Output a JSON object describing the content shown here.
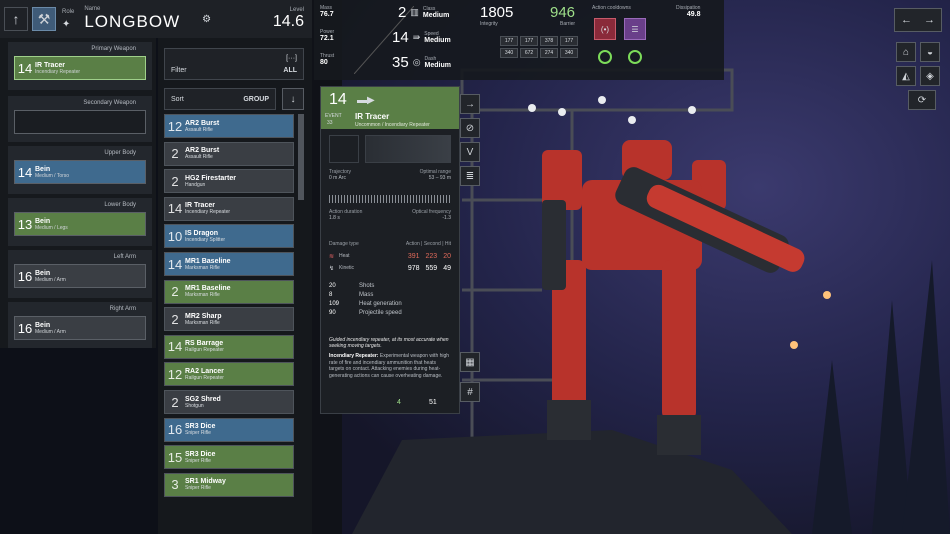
{
  "header": {
    "role_label": "Role",
    "name_label": "Name",
    "name": "LONGBOW",
    "level_label": "Level",
    "level": "14.6"
  },
  "top_stats": {
    "mass_label": "Mass",
    "mass": "76.7",
    "power_label": "Power",
    "power": "72.1",
    "thrust_label": "Thrust",
    "thrust": "80",
    "class_num": "2",
    "class_label": "Class",
    "class_val": "Medium",
    "speed_num": "14",
    "speed_label": "Speed",
    "speed_val": "Medium",
    "dash_num": "35",
    "dash_label": "Dash",
    "dash_val": "Medium",
    "integrity": "1805",
    "integrity_label": "Integrity",
    "barrier": "946",
    "barrier_label": "Barrier",
    "grid": [
      "177",
      "177",
      "378",
      "177",
      "340",
      "672",
      "274",
      "340"
    ],
    "cooldowns_label": "Action cooldowns",
    "dissipation_label": "Dissipation",
    "dissipation": "49.8"
  },
  "left": {
    "slots": [
      {
        "title": "Primary Weapon",
        "num": "14",
        "name": "IR Tracer",
        "sub": "Incendiary Repeater"
      },
      {
        "title": "Secondary Weapon",
        "num": "",
        "name": "",
        "sub": ""
      },
      {
        "title": "Upper Body",
        "num": "14",
        "name": "Bein",
        "sub": "Medium / Torso"
      },
      {
        "title": "Lower Body",
        "num": "13",
        "name": "Bein",
        "sub": "Medium / Legs"
      },
      {
        "title": "Left Arm",
        "num": "16",
        "name": "Bein",
        "sub": "Medium / Arm"
      },
      {
        "title": "Right Arm",
        "num": "16",
        "name": "Bein",
        "sub": "Medium / Arm"
      }
    ]
  },
  "list": {
    "filter_label": "Filter",
    "filter_val": "ALL",
    "sort_label": "Sort",
    "sort_val": "GROUP",
    "items": [
      {
        "num": "12",
        "name": "AR2 Burst",
        "sub": "Assault Rifle"
      },
      {
        "num": "2",
        "name": "AR2 Burst",
        "sub": "Assault Rifle"
      },
      {
        "num": "2",
        "name": "HG2 Firestarter",
        "sub": "Handgun"
      },
      {
        "num": "14",
        "name": "IR Tracer",
        "sub": "Incendiary Repeater"
      },
      {
        "num": "10",
        "name": "IS Dragon",
        "sub": "Incendiary Splitter"
      },
      {
        "num": "14",
        "name": "MR1 Baseline",
        "sub": "Marksman Rifle"
      },
      {
        "num": "2",
        "name": "MR1 Baseline",
        "sub": "Marksman Rifle"
      },
      {
        "num": "2",
        "name": "MR2 Sharp",
        "sub": "Marksman Rifle"
      },
      {
        "num": "14",
        "name": "RS Barrage",
        "sub": "Railgun Repeater"
      },
      {
        "num": "12",
        "name": "RA2 Lancer",
        "sub": "Railgun Repeater"
      },
      {
        "num": "2",
        "name": "SG2 Shred",
        "sub": "Shotgun"
      },
      {
        "num": "16",
        "name": "SR3 Dice",
        "sub": "Sniper Rifle"
      },
      {
        "num": "15",
        "name": "SR3 Dice",
        "sub": "Sniper Rifle"
      },
      {
        "num": "3",
        "name": "SR1 Midway",
        "sub": "Sniper Rifle"
      }
    ]
  },
  "card": {
    "num": "14",
    "name": "IR Tracer",
    "sub": "Uncommon / Incendiary Repeater",
    "tag1": "EVENT",
    "tag2": "33",
    "trajectory_label": "Trajectory",
    "trajectory": "0 m Arc",
    "optimal_label": "Optimal range",
    "optimal": "53 – 93 m",
    "action_label": "Action duration",
    "action": "1.8 s",
    "opt_freq_label": "Optical frequency",
    "opt_freq": "-1.3",
    "dmg_label": "Damage type",
    "dmg_cols": "Action | Second | Hit",
    "heat_label": "Heat",
    "heat": [
      "391",
      "223",
      "20"
    ],
    "kinetic_label": "Kinetic",
    "kinetic": [
      "978",
      "559",
      "49"
    ],
    "rows": [
      [
        "20",
        "Shots"
      ],
      [
        "8",
        "Mass"
      ],
      [
        "109",
        "Heat generation"
      ],
      [
        "90",
        "Projectile speed"
      ]
    ],
    "desc1": "Guided incendiary repeater, at its most accurate when seeking moving targets.",
    "desc2_title": "Incendiary Repeater:",
    "desc2": "Experimental weapon with high rate of fire and incendiary ammunition that heats targets on contact. Attacking enemies during heat-generating actions can cause overheating damage.",
    "footer_a": "4",
    "footer_b": "51"
  }
}
